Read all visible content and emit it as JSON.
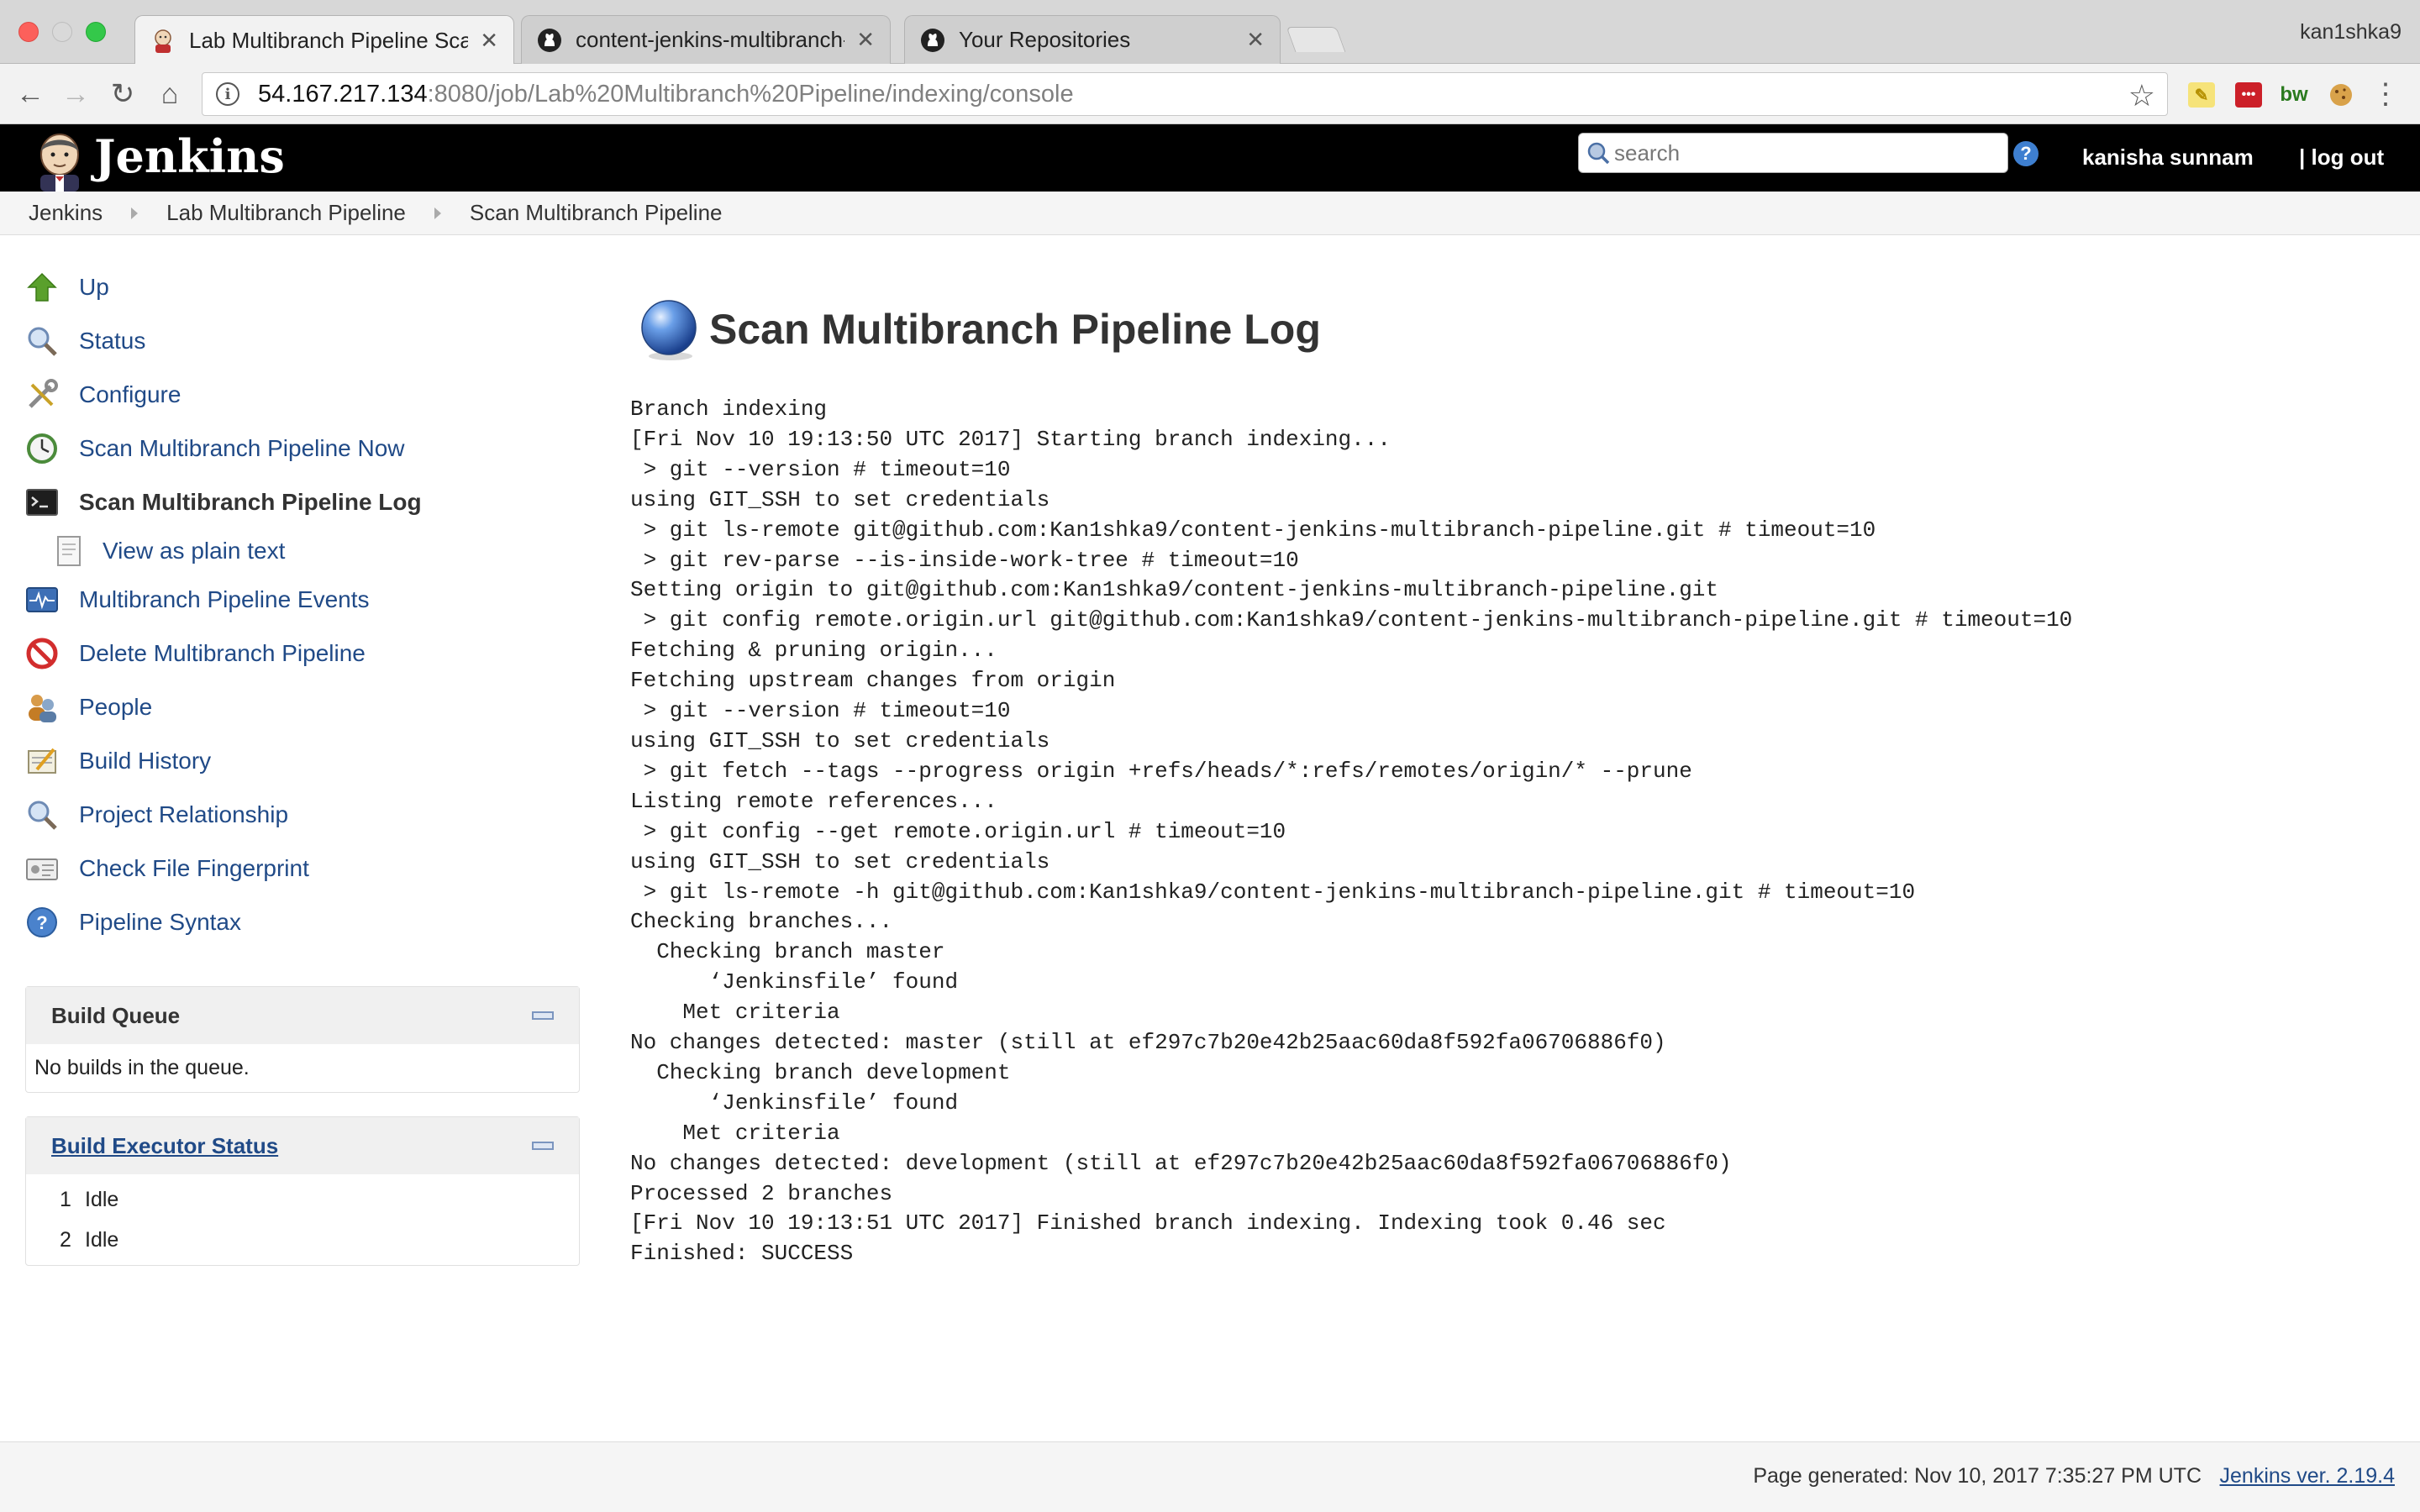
{
  "browser": {
    "tabs": [
      {
        "title": "Lab Multibranch Pipeline Scan",
        "icon": "jenkins-favicon-icon",
        "active": true
      },
      {
        "title": "content-jenkins-multibranch-p",
        "icon": "github-favicon-icon",
        "active": false
      },
      {
        "title": "Your Repositories",
        "icon": "github-favicon-icon",
        "active": false
      }
    ],
    "profile_name": "kan1shka9",
    "url_host": "54.167.217.134",
    "url_rest": ":8080/job/Lab%20Multibranch%20Pipeline/indexing/console",
    "extensions": [
      {
        "name": "sticky-note-extension-icon",
        "label": "",
        "color": "#f2d100"
      },
      {
        "name": "lastpass-extension-icon",
        "label": "•••",
        "color": "#cc2029"
      },
      {
        "name": "bw-extension-icon",
        "label": "bw",
        "color": "#2a7a1e"
      },
      {
        "name": "cookie-extension-icon",
        "label": "",
        "color": "#c98a2b"
      }
    ]
  },
  "jenkins": {
    "brand": "Jenkins",
    "search_placeholder": "search",
    "help_label": "?",
    "user_name": "kanisha sunnam",
    "logout_label": "log out",
    "colors": {
      "header_bg": "#000000",
      "link": "#204a87"
    }
  },
  "breadcrumbs": [
    "Jenkins",
    "Lab Multibranch Pipeline",
    "Scan Multibranch Pipeline"
  ],
  "sidebar": {
    "tasks": [
      {
        "label": "Up",
        "icon": "up-arrow-icon"
      },
      {
        "label": "Status",
        "icon": "magnifier-icon"
      },
      {
        "label": "Configure",
        "icon": "wrench-screwdriver-icon"
      },
      {
        "label": "Scan Multibranch Pipeline Now",
        "icon": "clock-refresh-icon"
      },
      {
        "label": "Scan Multibranch Pipeline Log",
        "icon": "terminal-icon",
        "current": true
      },
      {
        "label": "View as plain text",
        "icon": "document-icon",
        "sub": true
      },
      {
        "label": "Multibranch Pipeline Events",
        "icon": "monitor-pulse-icon"
      },
      {
        "label": "Delete Multibranch Pipeline",
        "icon": "no-entry-icon"
      },
      {
        "label": "People",
        "icon": "people-icon"
      },
      {
        "label": "Build History",
        "icon": "notepad-icon"
      },
      {
        "label": "Project Relationship",
        "icon": "magnifier-icon"
      },
      {
        "label": "Check File Fingerprint",
        "icon": "fingerprint-card-icon"
      },
      {
        "label": "Pipeline Syntax",
        "icon": "help-circle-icon"
      }
    ],
    "build_queue": {
      "title": "Build Queue",
      "empty_text": "No builds in the queue."
    },
    "executors": {
      "title": "Build Executor Status",
      "rows": [
        {
          "num": "1",
          "status": "Idle"
        },
        {
          "num": "2",
          "status": "Idle"
        }
      ]
    }
  },
  "main": {
    "title": "Scan Multibranch Pipeline Log",
    "console_lines": [
      "Branch indexing",
      "[Fri Nov 10 19:13:50 UTC 2017] Starting branch indexing...",
      " > git --version # timeout=10",
      "using GIT_SSH to set credentials",
      " > git ls-remote git@github.com:Kan1shka9/content-jenkins-multibranch-pipeline.git # timeout=10",
      " > git rev-parse --is-inside-work-tree # timeout=10",
      "Setting origin to git@github.com:Kan1shka9/content-jenkins-multibranch-pipeline.git",
      " > git config remote.origin.url git@github.com:Kan1shka9/content-jenkins-multibranch-pipeline.git # timeout=10",
      "Fetching & pruning origin...",
      "Fetching upstream changes from origin",
      " > git --version # timeout=10",
      "using GIT_SSH to set credentials",
      " > git fetch --tags --progress origin +refs/heads/*:refs/remotes/origin/* --prune",
      "Listing remote references...",
      " > git config --get remote.origin.url # timeout=10",
      "using GIT_SSH to set credentials",
      " > git ls-remote -h git@github.com:Kan1shka9/content-jenkins-multibranch-pipeline.git # timeout=10",
      "Checking branches...",
      "  Checking branch master",
      "      ‘Jenkinsfile’ found",
      "    Met criteria",
      "No changes detected: master (still at ef297c7b20e42b25aac60da8f592fa06706886f0)",
      "  Checking branch development",
      "      ‘Jenkinsfile’ found",
      "    Met criteria",
      "No changes detected: development (still at ef297c7b20e42b25aac60da8f592fa06706886f0)",
      "Processed 2 branches",
      "[Fri Nov 10 19:13:51 UTC 2017] Finished branch indexing. Indexing took 0.46 sec",
      "Finished: SUCCESS"
    ]
  },
  "footer": {
    "generated": "Page generated: Nov 10, 2017 7:35:27 PM UTC",
    "version": "Jenkins ver. 2.19.4"
  }
}
